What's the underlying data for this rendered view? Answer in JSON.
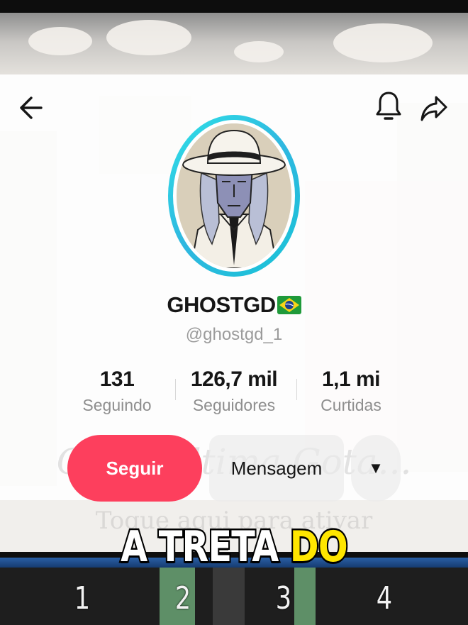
{
  "profile": {
    "display_name": "GHOSTGD",
    "handle": "@ghostgd_1",
    "stats": [
      {
        "value": "131",
        "label": "Seguindo"
      },
      {
        "value": "126,7 mil",
        "label": "Seguidores"
      },
      {
        "value": "1,1 mi",
        "label": "Curtidas"
      }
    ]
  },
  "actions": {
    "follow_label": "Seguir",
    "message_label": "Mensagem",
    "more_glyph": "▼"
  },
  "background": {
    "overlay_line1": "Cada Última Gota...",
    "overlay_line2": "Toque aqui para ativar"
  },
  "caption": {
    "word1": "A TRETA",
    "word2": "DO"
  },
  "slots": [
    "1",
    "2",
    "3",
    "4"
  ],
  "icons": {
    "back": "arrow-left-icon",
    "notifications": "bell-icon",
    "share": "share-arrow-icon",
    "flag": "brazil-flag-icon"
  },
  "colors": {
    "follow_button": "#fd3f5d",
    "avatar_ring": "#2fc8e2",
    "caption_highlight": "#ffe600"
  }
}
